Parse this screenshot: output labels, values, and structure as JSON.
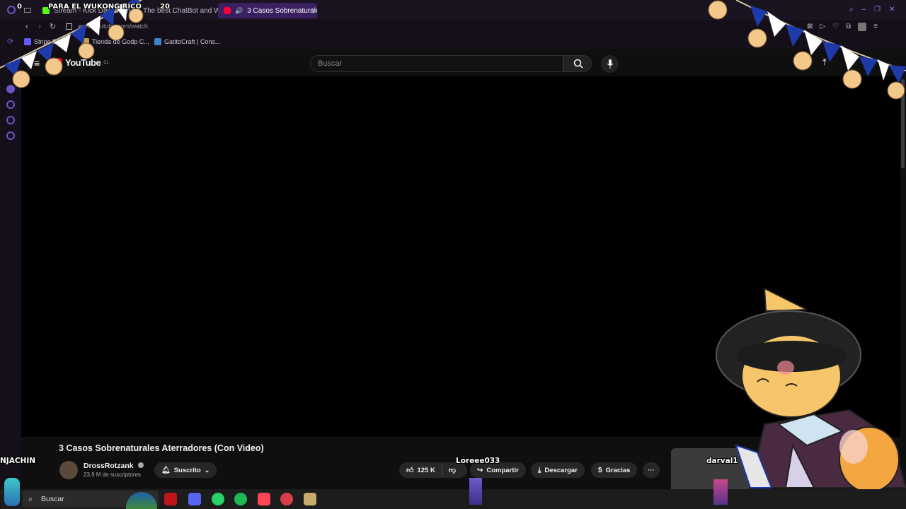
{
  "browser": {
    "tabs": [
      {
        "label": "Stream - Kick Dashboard",
        "favicon": "#53fc18",
        "active": false
      },
      {
        "label": "The best ChatBot and W",
        "favicon": "#7c5cff",
        "active": false
      },
      {
        "label": "3 Casos Sobrenaturale",
        "favicon": "#ff0033",
        "active": true
      }
    ],
    "address": "www.youtube.com/watch",
    "bookmarks": [
      "Stripe Expre",
      "Tienda de Godp C...",
      "GatitoCraft | Cons..."
    ],
    "icons": [
      "back-icon",
      "forward-icon",
      "reload-icon",
      "lock-icon",
      "extensions-icon",
      "menu-icon"
    ]
  },
  "youtube": {
    "logo": "YouTube",
    "region": "CL",
    "search_placeholder": "Buscar",
    "video": {
      "title": "3 Casos Sobrenaturales Aterradores (Con Video)",
      "channel": "DrossRotzank",
      "subscribers": "23,9 M de suscriptores",
      "subscribe_label": "Suscrito",
      "likes": "125 K",
      "share_label": "Compartir",
      "download_label": "Descargar",
      "thanks_label": "Gracias"
    }
  },
  "overlay": {
    "counter_left": "0",
    "banner": "PARA EL WUKONG RICO",
    "counter_right": "20",
    "viewer_left": "NJACHIN",
    "viewer_center": "Loreee033",
    "viewer_right": "darval1"
  },
  "taskbar": {
    "search_label": "Buscar",
    "apps": [
      {
        "name": "app-red",
        "color": "#c0151a"
      },
      {
        "name": "discord-icon",
        "color": "#5865f2"
      },
      {
        "name": "whatsapp-icon",
        "color": "#25d366"
      },
      {
        "name": "spotify-icon",
        "color": "#1db954"
      },
      {
        "name": "valorant-icon",
        "color": "#ff4655"
      },
      {
        "name": "app-circle",
        "color": "#d63f4a"
      },
      {
        "name": "league-icon",
        "color": "#c8aa6e"
      }
    ]
  },
  "colors": {
    "accent": "#3a2060",
    "yt_red": "#ff0033",
    "bunting_blue": "#1d3aa8",
    "bunting_red": "#c8102e"
  }
}
